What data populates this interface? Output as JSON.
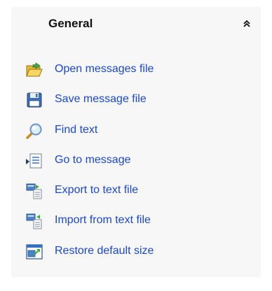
{
  "panel": {
    "title": "General",
    "collapse_icon": "double-chevron-up-icon"
  },
  "items": [
    {
      "label": "Open messages file",
      "icon": "folder-open-icon"
    },
    {
      "label": "Save message file",
      "icon": "floppy-disk-icon"
    },
    {
      "label": "Find text",
      "icon": "magnifier-icon"
    },
    {
      "label": "Go to message",
      "icon": "go-to-message-icon"
    },
    {
      "label": "Export to text file",
      "icon": "export-icon"
    },
    {
      "label": "Import from text file",
      "icon": "import-icon"
    },
    {
      "label": "Restore default size",
      "icon": "restore-size-icon"
    }
  ],
  "colors": {
    "link": "#1a47d8",
    "panel_bg": "#f7f7f7"
  }
}
